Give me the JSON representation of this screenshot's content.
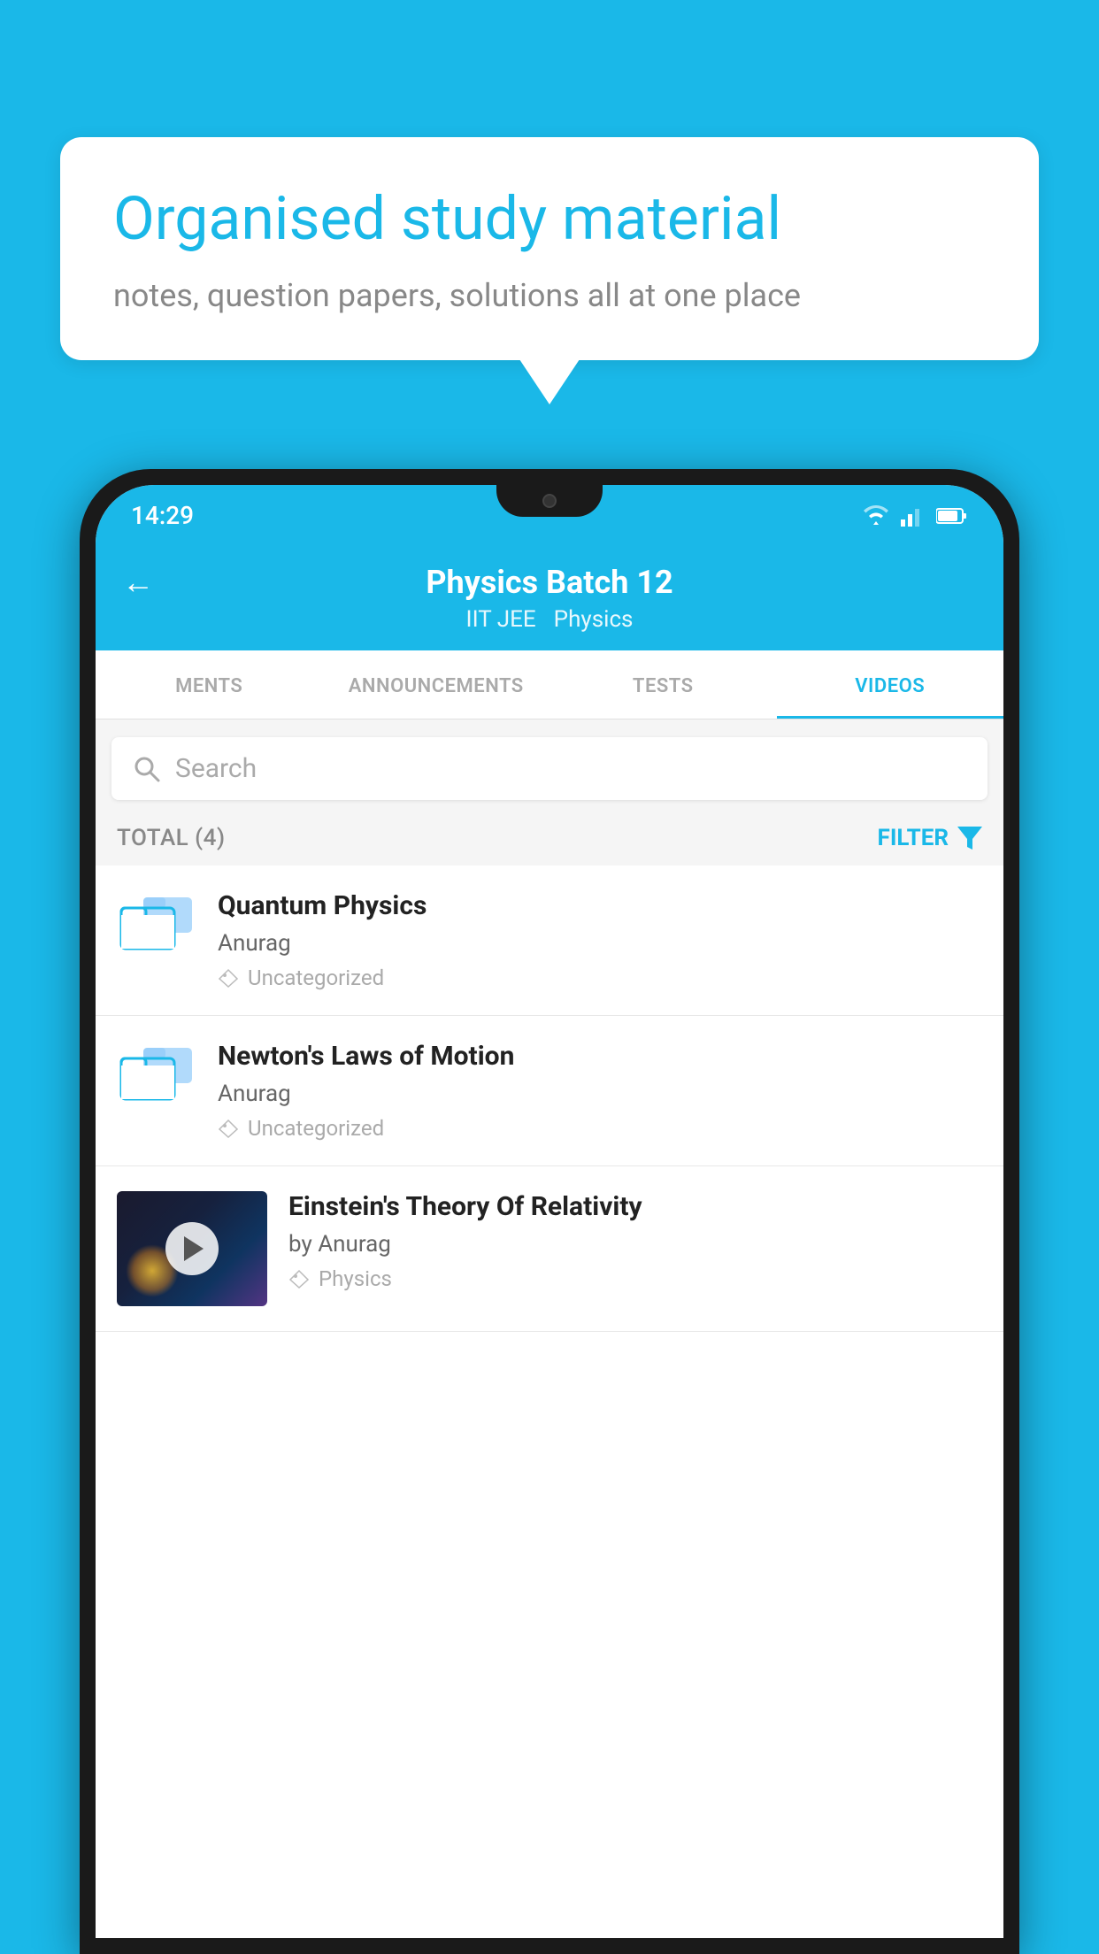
{
  "background_color": "#1ab8e8",
  "speech_bubble": {
    "heading": "Organised study material",
    "subtext": "notes, question papers, solutions all at one place"
  },
  "status_bar": {
    "time": "14:29"
  },
  "header": {
    "title": "Physics Batch 12",
    "tag1": "IIT JEE",
    "tag2": "Physics"
  },
  "tabs": [
    {
      "label": "MENTS",
      "active": false
    },
    {
      "label": "ANNOUNCEMENTS",
      "active": false
    },
    {
      "label": "TESTS",
      "active": false
    },
    {
      "label": "VIDEOS",
      "active": true
    }
  ],
  "search": {
    "placeholder": "Search"
  },
  "filter_row": {
    "total_label": "TOTAL (4)",
    "filter_label": "FILTER"
  },
  "videos": [
    {
      "title": "Quantum Physics",
      "author": "Anurag",
      "tag": "Uncategorized",
      "type": "folder"
    },
    {
      "title": "Newton's Laws of Motion",
      "author": "Anurag",
      "tag": "Uncategorized",
      "type": "folder"
    },
    {
      "title": "Einstein's Theory Of Relativity",
      "author": "by Anurag",
      "tag": "Physics",
      "type": "video"
    }
  ]
}
